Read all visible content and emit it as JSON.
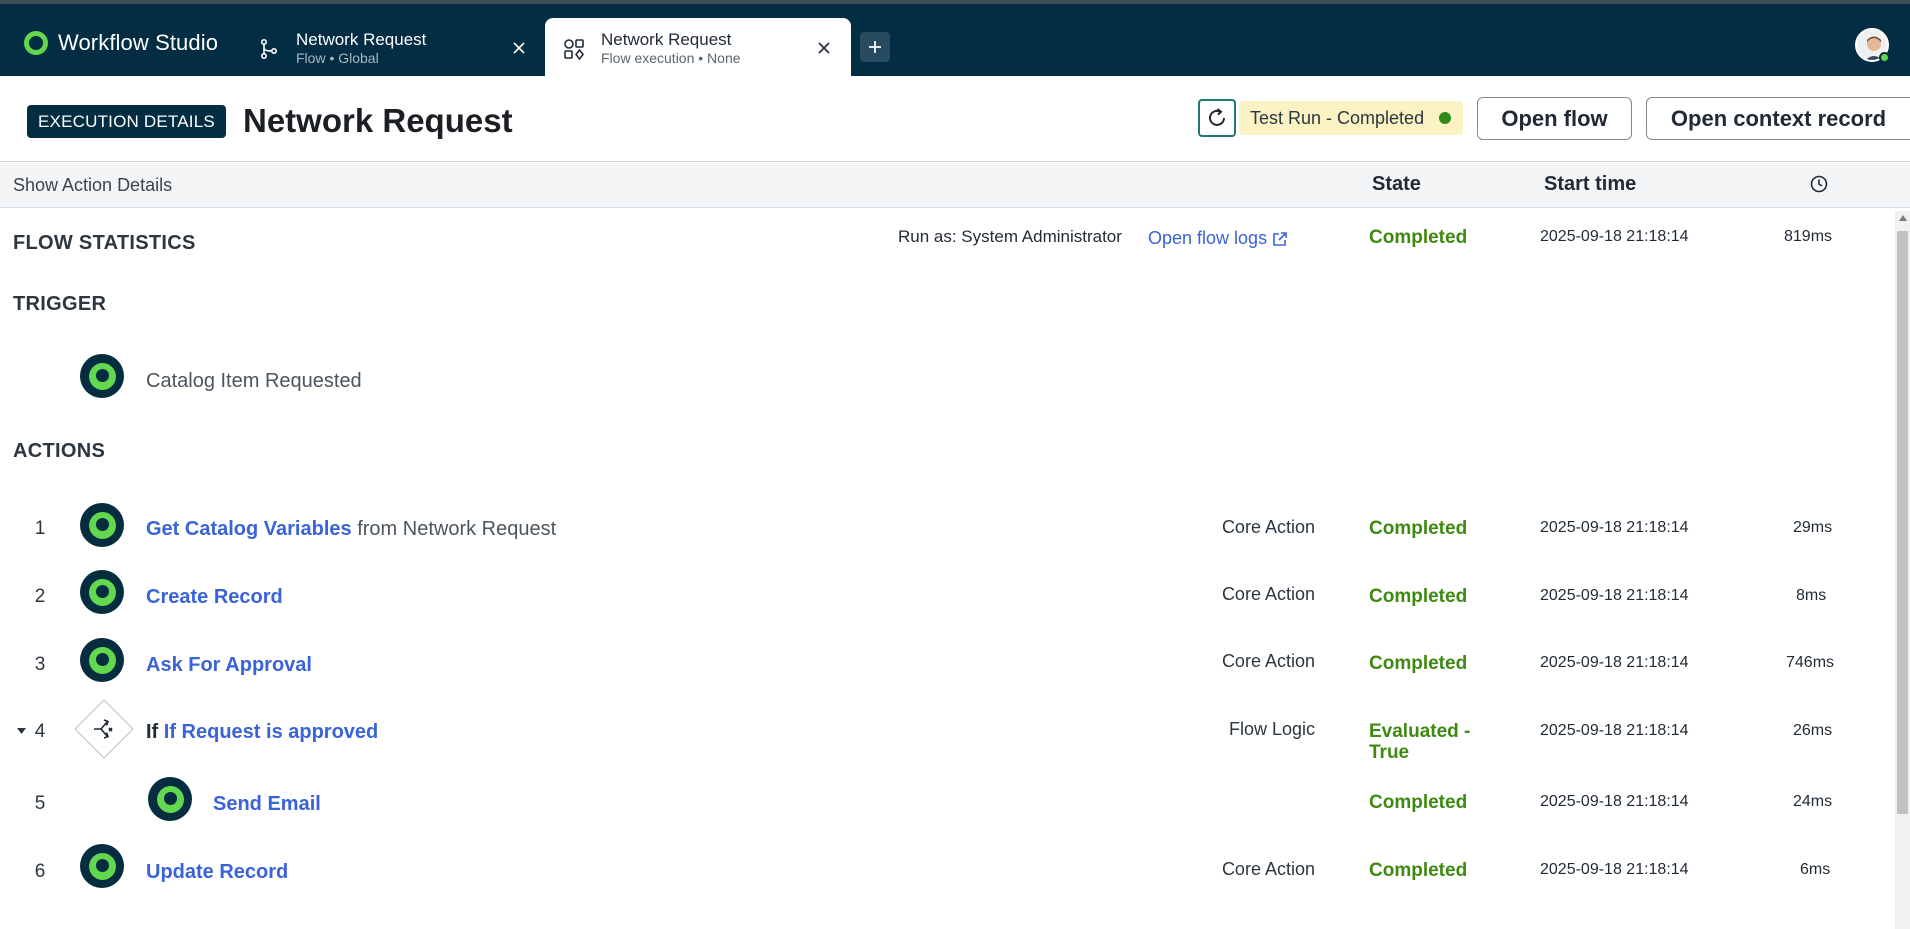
{
  "app": {
    "title": "Workflow Studio",
    "tabs": [
      {
        "title": "Network Request",
        "subtitle": "Flow • Global",
        "icon": "flow-icon"
      },
      {
        "title": "Network Request",
        "subtitle": "Flow execution • None",
        "icon": "execution-icon"
      }
    ],
    "add_tab_icon": "plus-icon"
  },
  "header": {
    "badge": "EXECUTION DETAILS",
    "title": "Network Request",
    "run_status": "Test Run - Completed",
    "open_flow_label": "Open flow",
    "open_context_label": "Open context record"
  },
  "columns": {
    "toggle_label": "Show Action Details",
    "state": "State",
    "start_time": "Start time",
    "duration_icon": "clock-icon"
  },
  "flow_statistics": {
    "label": "FLOW STATISTICS",
    "run_as": "Run as: System Administrator",
    "logs_link": "Open flow logs",
    "state": "Completed",
    "start_time": "2025-09-18 21:18:14",
    "duration": "819ms"
  },
  "trigger": {
    "label": "TRIGGER",
    "name": "Catalog Item Requested"
  },
  "actions": {
    "label": "ACTIONS",
    "rows": [
      {
        "num": "1",
        "name": "Get Catalog Variables",
        "suffix": "from Network Request",
        "type": "Core Action",
        "state": "Completed",
        "start": "2025-09-18 21:18:14",
        "duration": "29ms"
      },
      {
        "num": "2",
        "name": "Create Record",
        "type": "Core Action",
        "state": "Completed",
        "start": "2025-09-18 21:18:14",
        "duration": "8ms"
      },
      {
        "num": "3",
        "name": "Ask For Approval",
        "type": "Core Action",
        "state": "Completed",
        "start": "2025-09-18 21:18:14",
        "duration": "746ms"
      },
      {
        "num": "4",
        "prefix": "If",
        "name": "If Request is approved",
        "type": "Flow Logic",
        "state": "Evaluated - True",
        "start": "2025-09-18 21:18:14",
        "duration": "26ms"
      },
      {
        "num": "5",
        "name": "Send Email",
        "type": "",
        "state": "Completed",
        "start": "2025-09-18 21:18:14",
        "duration": "24ms"
      },
      {
        "num": "6",
        "name": "Update Record",
        "type": "Core Action",
        "state": "Completed",
        "start": "2025-09-18 21:18:14",
        "duration": "6ms"
      }
    ]
  },
  "colors": {
    "nav_bg": "#032d42",
    "brand_green": "#62d84e",
    "link_blue": "#3a63d8",
    "completed_green": "#3e8a10",
    "status_bg": "#fbf3c4"
  }
}
